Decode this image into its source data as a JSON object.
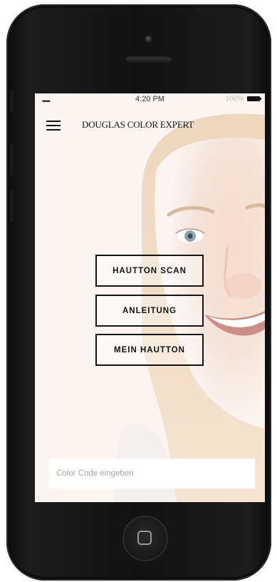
{
  "status_bar": {
    "signal": "•••••",
    "time": "4:20 PM",
    "battery": "100%"
  },
  "app": {
    "title": "DOUGLAS COLOR EXPERT",
    "menu_icon": "hamburger-menu-icon"
  },
  "buttons": {
    "scan": "HAUTTON SCAN",
    "guide": "ANLEITUNG",
    "my_tone": "MEIN HAUTTON"
  },
  "color_code": {
    "placeholder": "Color Code eingeben",
    "value": ""
  },
  "colors": {
    "screen_bg": "#fbf4f1",
    "button_border": "#141414",
    "phone_body": "#121212"
  }
}
